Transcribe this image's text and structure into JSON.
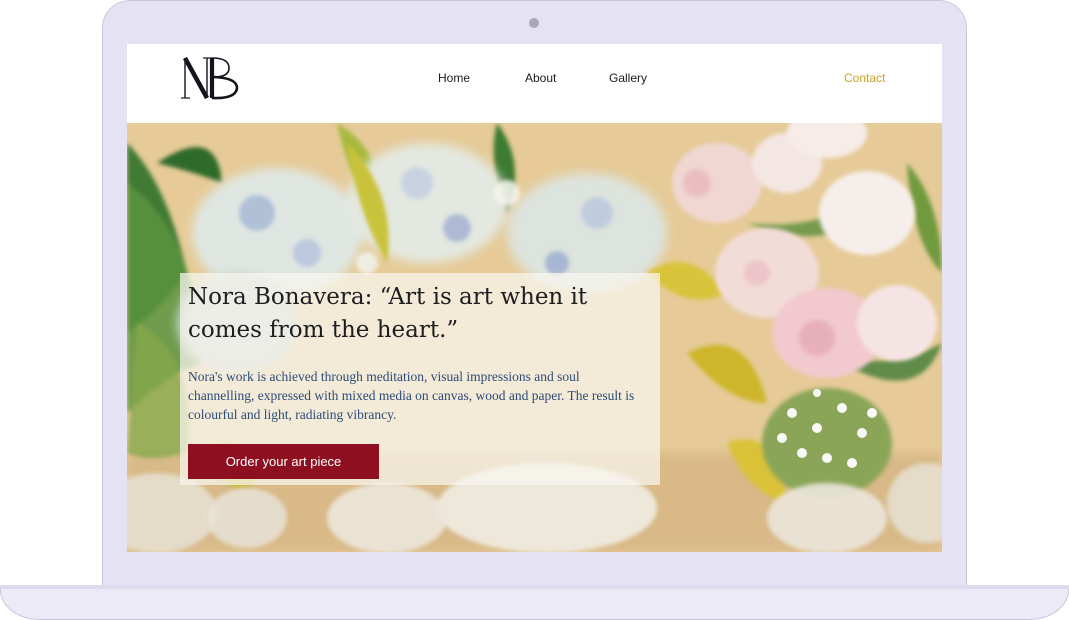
{
  "site": {
    "logo_text": "NB"
  },
  "nav": {
    "home": "Home",
    "about": "About",
    "gallery": "Gallery",
    "contact": "Contact"
  },
  "hero": {
    "headline": "Nora Bonavera: “Art is art when it comes from the heart.”",
    "description": "Nora's work is achieved through meditation, visual impressions and soul channelling, expressed with mixed media on canvas, wood and paper.  The result is colourful and light, radiating vibrancy.",
    "cta_label": "Order your art piece"
  },
  "colors": {
    "accent_contact": "#c9a227",
    "cta_background": "#8e1020",
    "blurb_text": "#2c4a78",
    "frame": "#e5e3f3"
  }
}
